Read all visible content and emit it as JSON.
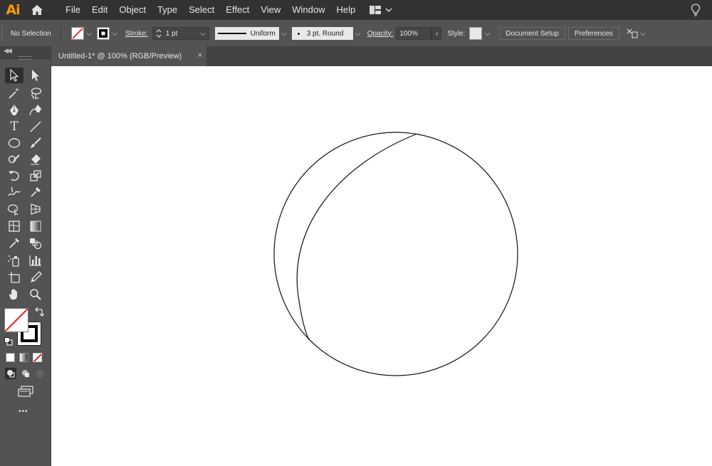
{
  "app": {
    "logo_text": "Ai"
  },
  "menu": [
    "File",
    "Edit",
    "Object",
    "Type",
    "Select",
    "Effect",
    "View",
    "Window",
    "Help"
  ],
  "control_bar": {
    "selection_status": "No Selection",
    "stroke_label": "Stroke:",
    "stroke_weight": "1 pt",
    "variable_width_profile": "Uniform",
    "brush_definition": "3 pt. Round",
    "opacity_label": "Opacity:",
    "opacity_value": "100%",
    "style_label": "Style:",
    "document_setup_button": "Document Setup",
    "preferences_button": "Preferences"
  },
  "document_tab": {
    "title": "Untitled-1* @ 100% (RGB/Preview)",
    "close_glyph": "×"
  },
  "toolbar": {
    "tools": [
      "selection-tool",
      "direct-selection-tool",
      "magic-wand-tool",
      "lasso-tool",
      "pen-tool",
      "curvature-tool",
      "type-tool",
      "line-segment-tool",
      "ellipse-tool",
      "paintbrush-tool",
      "shaper-tool",
      "eraser-tool",
      "rotate-tool",
      "scale-tool",
      "warp-tool",
      "puppet-warp-tool",
      "shape-builder-tool",
      "perspective-grid-tool",
      "mesh-tool",
      "gradient-tool",
      "eyedropper-tool",
      "blend-tool",
      "symbol-sprayer-tool",
      "column-graph-tool",
      "artboard-tool",
      "slice-tool",
      "hand-tool",
      "zoom-tool"
    ],
    "edit_toolbar_glyph": "•••"
  },
  "colors": {
    "chrome_dark": "#323232",
    "chrome": "#535353",
    "canvas": "#ffffff",
    "logo": "#ff9a00",
    "none_slash": "#e0201f"
  }
}
